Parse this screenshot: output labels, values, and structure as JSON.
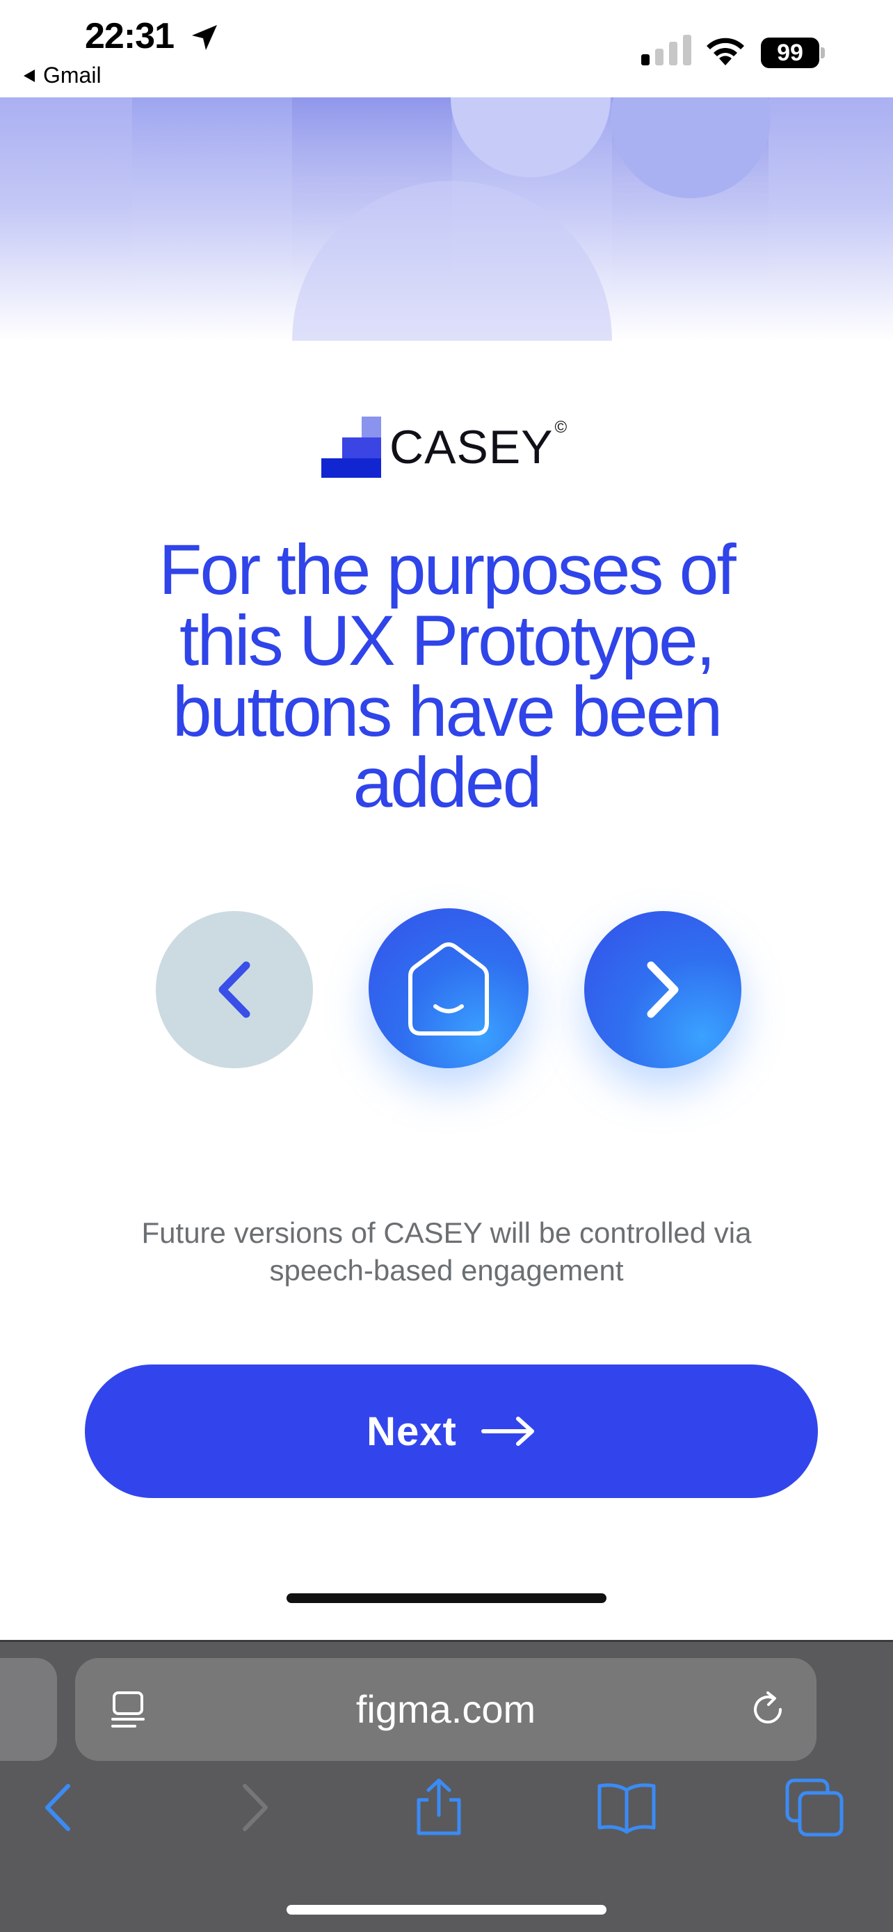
{
  "status_bar": {
    "time": "22:31",
    "back_app": "Gmail",
    "battery": "99"
  },
  "logo": {
    "brand": "CASEY",
    "mark": "©"
  },
  "headline": {
    "lines": [
      "For the purposes of",
      "this UX Prototype,",
      "buttons have been",
      "added"
    ]
  },
  "buttons": {
    "previous_icon": "chevron-left-icon",
    "home_icon": "smiling-house-icon",
    "next_icon": "chevron-right-icon"
  },
  "caption": {
    "lines": [
      "Future versions of CASEY will be controlled via",
      "speech-based engagement"
    ]
  },
  "next_button": {
    "label": "Next"
  },
  "browser": {
    "url": "figma.com"
  },
  "colors": {
    "accent": "#3245ec",
    "headline": "#2f44e9",
    "prev_button": "#ccdbe1",
    "caption": "#6b6f72"
  }
}
